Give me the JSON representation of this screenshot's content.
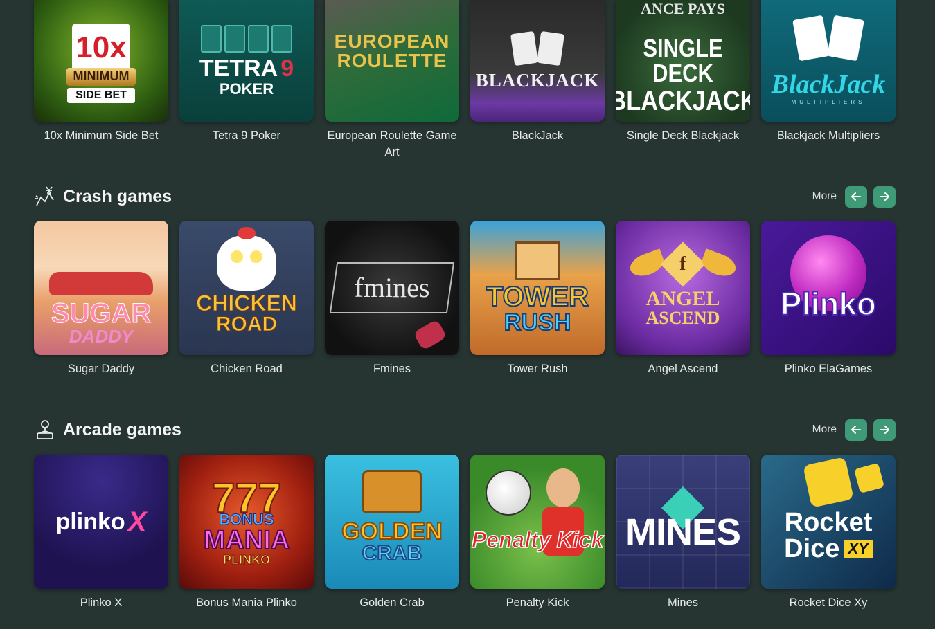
{
  "row_top": [
    {
      "title": "10x Minimum Side Bet",
      "art": [
        "10x",
        "MINIMUM",
        "SIDE BET"
      ]
    },
    {
      "title": "Tetra 9 Poker",
      "art": [
        "TETRA",
        "9",
        "POKER"
      ]
    },
    {
      "title": "European Roulette Game Art",
      "art": [
        "EUROPEAN",
        "ROULETTE"
      ]
    },
    {
      "title": "BlackJack",
      "art": [
        "BLACKJACK"
      ]
    },
    {
      "title": "Single Deck Blackjack",
      "art": [
        "ANCE PAYS",
        "SINGLE DECK",
        "BLACKJACK"
      ]
    },
    {
      "title": "Blackjack Multipliers",
      "art": [
        "BlackJack",
        "MULTIPLIERS"
      ]
    }
  ],
  "crash": {
    "heading": "Crash games",
    "more_label": "More",
    "games": [
      {
        "title": "Sugar Daddy",
        "art": [
          "SUGAR",
          "DADDY"
        ]
      },
      {
        "title": "Chicken Road",
        "art": [
          "CHICKEN",
          "ROAD"
        ]
      },
      {
        "title": "Fmines",
        "art": [
          "fmines"
        ]
      },
      {
        "title": "Tower Rush",
        "art": [
          "TOWER",
          "RUSH"
        ]
      },
      {
        "title": "Angel Ascend",
        "art": [
          "f",
          "ANGEL",
          "ASCEND"
        ]
      },
      {
        "title": "Plinko ElaGames",
        "art": [
          "Plinko"
        ]
      }
    ]
  },
  "arcade": {
    "heading": "Arcade games",
    "more_label": "More",
    "games": [
      {
        "title": "Plinko X",
        "art": [
          "plinko",
          "X"
        ]
      },
      {
        "title": "Bonus Mania Plinko",
        "art": [
          "777",
          "BONUS",
          "MANIA",
          "PLINKO"
        ]
      },
      {
        "title": "Golden Crab",
        "art": [
          "GOLDEN",
          "CRAB"
        ]
      },
      {
        "title": "Penalty Kick",
        "art": [
          "Penalty Kick"
        ]
      },
      {
        "title": "Mines",
        "art": [
          "MINES"
        ]
      },
      {
        "title": "Rocket Dice Xy",
        "art": [
          "Rocket",
          "Dice",
          "XY"
        ]
      }
    ]
  },
  "colors": {
    "background": "#263432",
    "accent": "#3f9a78"
  }
}
